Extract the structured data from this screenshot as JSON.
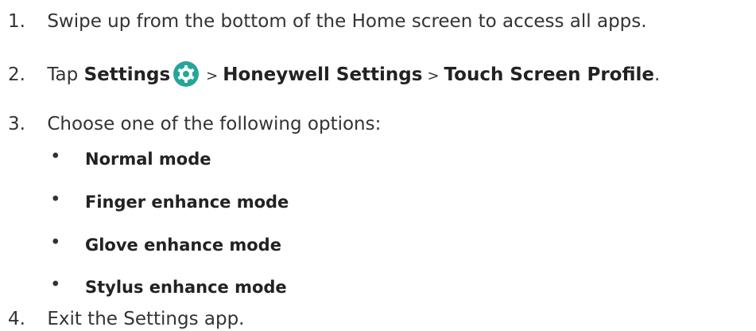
{
  "steps": [
    {
      "num": "1.",
      "text": "Swipe up from the bottom of the Home screen to access all apps."
    },
    {
      "num": "2.",
      "prefix": "Tap ",
      "settings": "Settings",
      "sep1": ">",
      "honeywell": "Honeywell Settings",
      "sep2": ">",
      "profile": "Touch Screen Profile",
      "end": "."
    },
    {
      "num": "3.",
      "text": "Choose one of the following options:"
    },
    {
      "num": "4.",
      "text": "Exit the Settings app."
    }
  ],
  "options": [
    {
      "bullet": "•",
      "label": "Normal mode"
    },
    {
      "bullet": "•",
      "label": "Finger enhance mode"
    },
    {
      "bullet": "•",
      "label": "Glove enhance mode"
    },
    {
      "bullet": "•",
      "label": "Stylus enhance mode"
    }
  ],
  "colors": {
    "settings_icon": "#26a69a"
  },
  "icons": {
    "settings": "gear-icon"
  }
}
